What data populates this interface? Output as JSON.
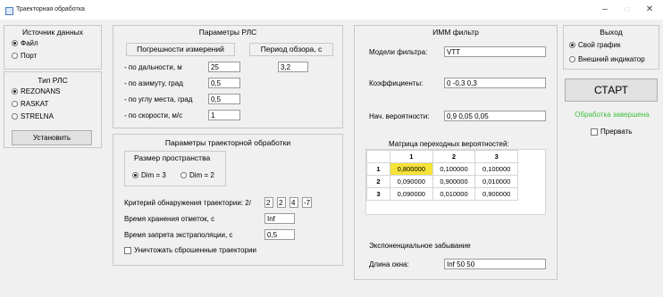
{
  "window": {
    "title": "Траекторная обработка",
    "minimize_icon": "minimize-icon",
    "maximize_icon": "maximize-icon",
    "close_icon": "close-icon"
  },
  "source": {
    "title": "Источник данных",
    "options": [
      "Файл",
      "Порт"
    ],
    "selected": 0
  },
  "radar_type": {
    "title": "Тип РЛС",
    "options": [
      "REZONANS",
      "RASKAT",
      "STRELNA"
    ],
    "selected": 0,
    "set_button": "Установить"
  },
  "rls_params": {
    "title": "Параметры РЛС",
    "errors_header": "Погрешности измерений",
    "period_header": "Период обзора, с",
    "rows": [
      {
        "label": "- по дальности, м",
        "value": "25"
      },
      {
        "label": "- по азимуту, град",
        "value": "0,5"
      },
      {
        "label": "- по углу места, град",
        "value": "0,5"
      },
      {
        "label": "- по скорости, м/с",
        "value": "1"
      }
    ],
    "period": "3,2"
  },
  "traj": {
    "title": "Параметры траекторной обработки",
    "space_title": "Размер пространства",
    "dims": [
      "Dim = 3",
      "Dim = 2"
    ],
    "dim_selected": 0,
    "criterion_label": "Критерий обнаружения траектории: 2/",
    "criterion": [
      "2",
      "2",
      "4",
      "-7"
    ],
    "storage_label": "Время хранения отметок, с",
    "storage": "Inf",
    "extrap_label": "Время запрета экстраполяции, с",
    "extrap": "0,5",
    "destroy_label": "Уничтожать сброшенные траектории"
  },
  "imm": {
    "title": "ИММ фильтр",
    "models_label": "Модели фильтра:",
    "models": "VTT",
    "coef_label": "Коэффициенты:",
    "coef": "0 -0,3 0,3",
    "prob_label": "Нач. вероятности:",
    "prob": "0,9 0,05 0,05",
    "matrix_title": "Матрица переходных вероятностей:",
    "matrix_cols": [
      "1",
      "2",
      "3"
    ],
    "matrix_rows": [
      {
        "h": "1",
        "v": [
          "0,800000",
          "0,100000",
          "0,100000"
        ]
      },
      {
        "h": "2",
        "v": [
          "0,090000",
          "0,900000",
          "0,010000"
        ]
      },
      {
        "h": "3",
        "v": [
          "0,090000",
          "0,010000",
          "0,900000"
        ]
      }
    ],
    "forget_title": "Экспоненциальное забывание",
    "window_label": "Длина окна:",
    "window": "Inf 50 50"
  },
  "output": {
    "title": "Выход",
    "options": [
      "Свой график",
      "Внешний индикатор"
    ],
    "selected": 0,
    "start": "СТАРТ",
    "status": "Обработка завершена",
    "status_color": "#3fbf3f",
    "interrupt": "Прервать"
  }
}
